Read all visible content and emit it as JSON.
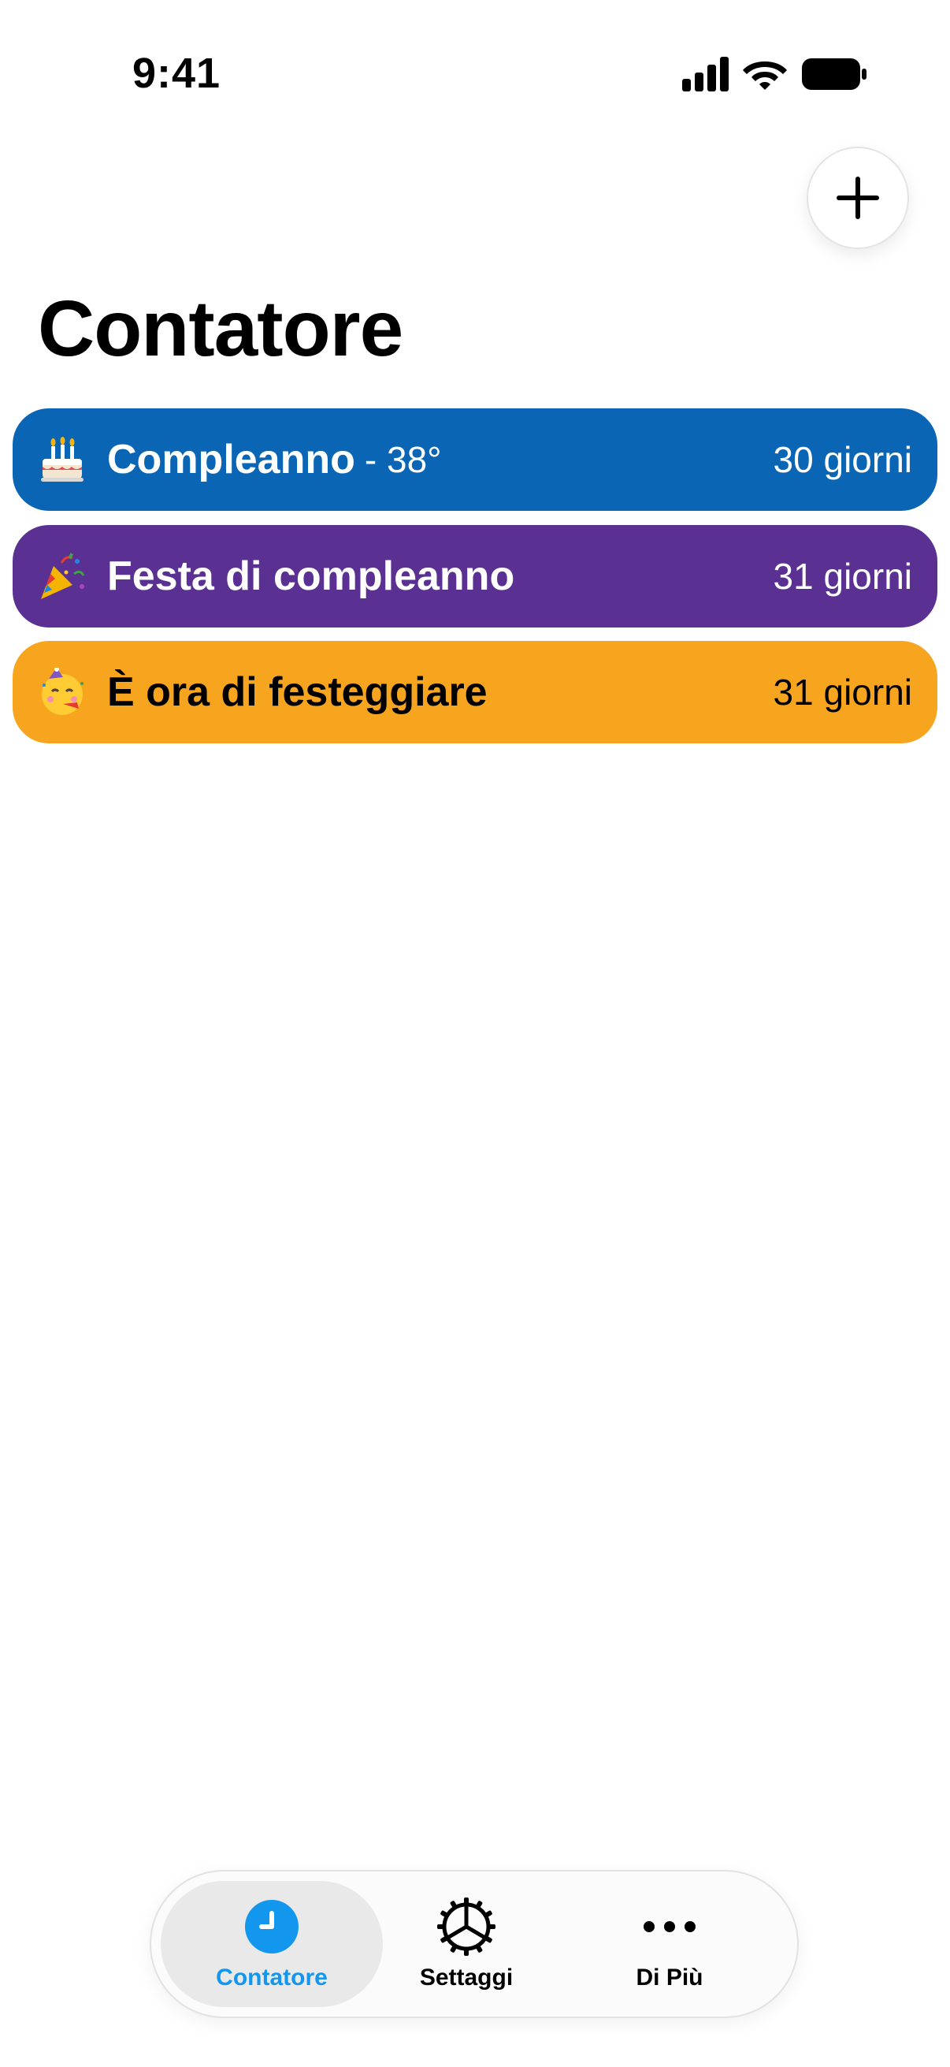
{
  "status_bar": {
    "time": "9:41",
    "icons": [
      "cellular-signal-icon",
      "wifi-icon",
      "battery-icon"
    ]
  },
  "header": {
    "add_icon": "plus-icon",
    "title": "Contatore"
  },
  "counters": [
    {
      "emoji": "🎂",
      "icon": "birthday-cake-icon",
      "title": "Compleanno",
      "subtitle": "- 38°",
      "days": "30 giorni",
      "color": "#0A66B5",
      "text_color": "#FFFFFF"
    },
    {
      "emoji": "🎉",
      "icon": "party-popper-icon",
      "title": "Festa di compleanno",
      "subtitle": "",
      "days": "31 giorni",
      "color": "#5A3192",
      "text_color": "#FFFFFF"
    },
    {
      "emoji": "🥳",
      "icon": "partying-face-icon",
      "title": "È ora di festeggiare",
      "subtitle": "",
      "days": "31 giorni",
      "color": "#F7A41E",
      "text_color": "#000000"
    }
  ],
  "tab_bar": {
    "tabs": [
      {
        "label": "Contatore",
        "icon": "clock-icon",
        "active": true,
        "color": "#1296EE"
      },
      {
        "label": "Settaggi",
        "icon": "gear-icon",
        "active": false,
        "color": "#000000"
      },
      {
        "label": "Di Più",
        "icon": "more-icon",
        "active": false,
        "color": "#000000"
      }
    ]
  }
}
